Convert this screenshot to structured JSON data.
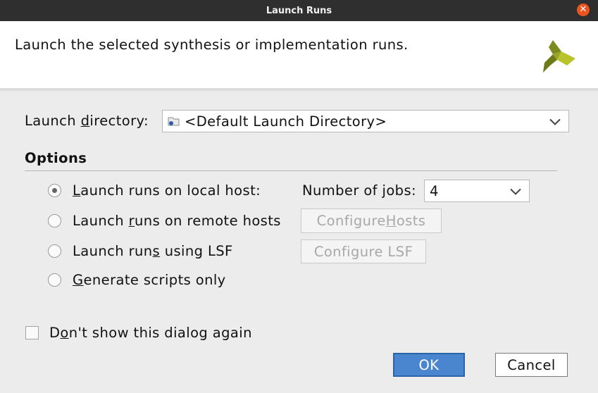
{
  "window": {
    "title": "Launch Runs",
    "close_glyph": "✕"
  },
  "header": {
    "description": "Launch the selected synthesis or implementation runs.",
    "logo_icon": "xilinx-logo-icon"
  },
  "launch_directory": {
    "label_pre": "Launch ",
    "label_mnemonic": "d",
    "label_post": "irectory:",
    "value": "<Default Launch Directory>",
    "icon": "folder-icon"
  },
  "options": {
    "title": "Options",
    "local": {
      "pre": "",
      "mnemonic": "L",
      "post": "aunch runs on local host:",
      "selected": true
    },
    "jobs": {
      "label": "Number of jobs:",
      "value": "4"
    },
    "remote": {
      "pre": "Launch ",
      "mnemonic": "r",
      "post": "uns on remote hosts",
      "selected": false,
      "button_pre": "Configure ",
      "button_mnemonic": "H",
      "button_post": "osts"
    },
    "lsf": {
      "pre": "Launch run",
      "mnemonic": "s",
      "post": " using LSF",
      "selected": false,
      "button_label": "Configure LSF"
    },
    "scripts": {
      "pre": "",
      "mnemonic": "G",
      "post": "enerate scripts only",
      "selected": false
    }
  },
  "dont_show": {
    "pre": "D",
    "mnemonic": "o",
    "post": "n't show this dialog again",
    "checked": false
  },
  "buttons": {
    "ok": "OK",
    "cancel": "Cancel"
  },
  "colors": {
    "titlebar": "#2f2f2f",
    "close": "#e95420",
    "ok_button": "#4a86cf"
  }
}
